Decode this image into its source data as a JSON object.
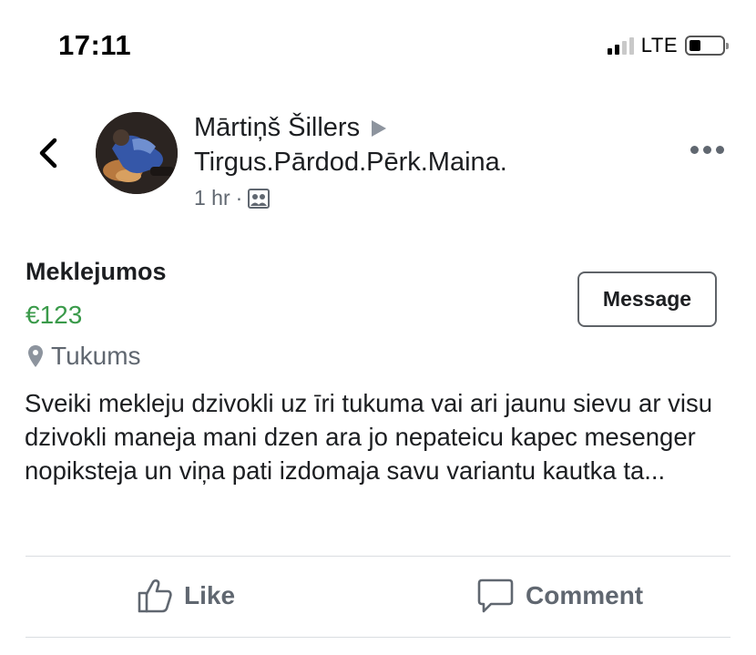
{
  "status_bar": {
    "time": "17:11",
    "network": "LTE",
    "signal_bars_active": 2,
    "signal_bars_total": 4,
    "battery_level": 0.35
  },
  "post": {
    "author": "Mārtiņš Šillers",
    "group": "Tirgus.Pārdod.Pērk.Maina.",
    "time_ago": "1 hr",
    "meta_separator": "·",
    "audience_icon": "group-audience-icon"
  },
  "listing": {
    "title": "Meklejumos",
    "price": "€123",
    "location": "Tukums",
    "message_button": "Message",
    "description": "Sveiki mekleju dzivokli uz īri tukuma vai ari jaunu sievu ar visu dzivokli maneja mani dzen ara jo nepateicu kapec mesenger nopiksteja un viņa pati izdomaja savu variantu kautka ta..."
  },
  "actions": {
    "like": "Like",
    "comment": "Comment"
  },
  "colors": {
    "price": "#3a9a4a",
    "secondary_text": "#606770",
    "divider": "#dadde1"
  }
}
